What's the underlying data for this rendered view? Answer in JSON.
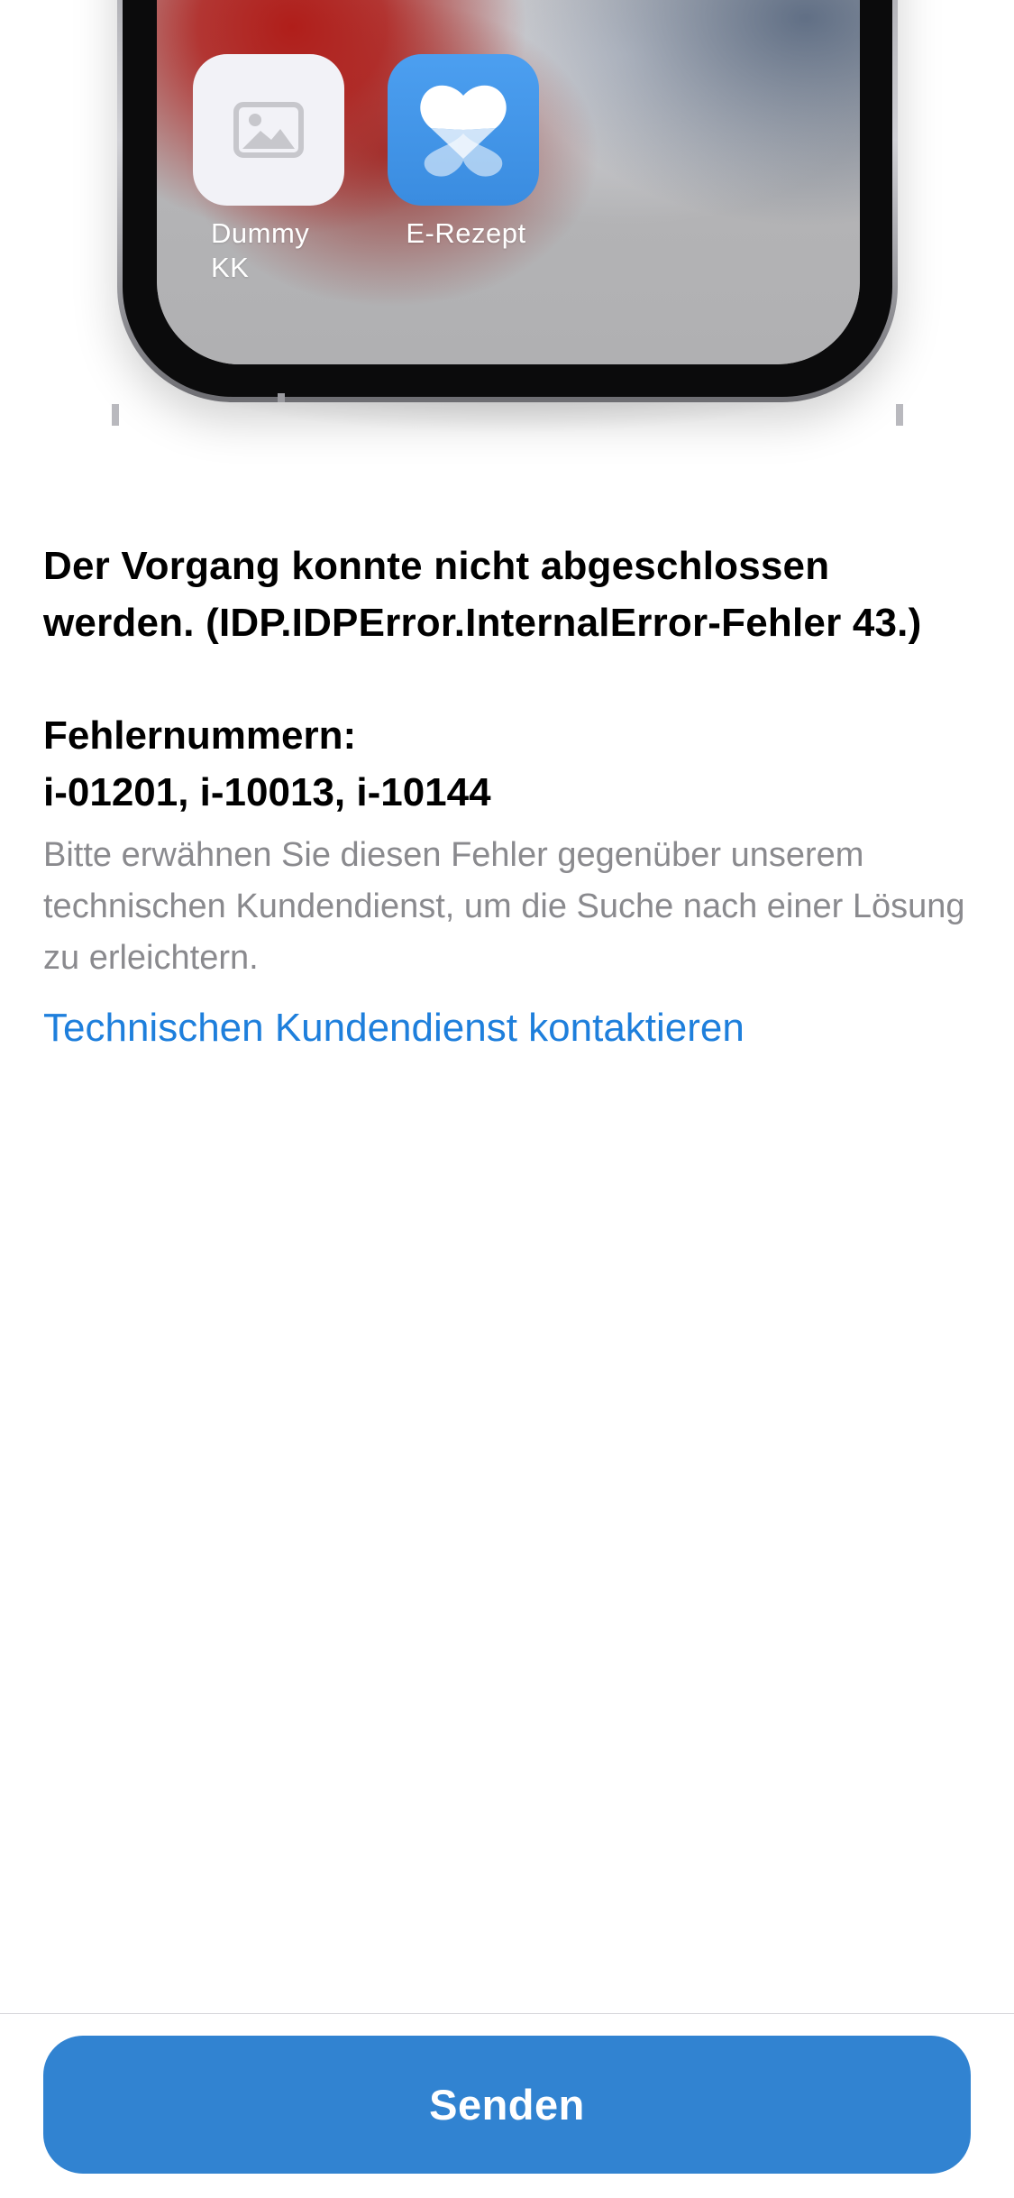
{
  "illustration": {
    "apps": [
      {
        "label": "Dummy KK",
        "icon": "image-placeholder-icon"
      },
      {
        "label": "E-Rezept",
        "icon": "e-rezept-heart-icon"
      }
    ]
  },
  "error": {
    "message": "Der Vorgang konnte nicht abgeschlossen werden. (IDP.IDPError.InternalError-Fehler 43.)",
    "numbers_heading": "Fehlernummern:",
    "numbers": "i-01201, i-10013, i-10144",
    "hint": "Bitte erwähnen Sie diesen Fehler gegenüber unserem technischen Kundendienst, um die Suche nach einer Lösung zu erleichtern.",
    "support_link": "Technischen Kundendienst kontaktieren"
  },
  "footer": {
    "send_label": "Senden"
  },
  "colors": {
    "accent": "#3183d1",
    "link": "#1e7fdc",
    "secondary_text": "#8a8a8e"
  }
}
